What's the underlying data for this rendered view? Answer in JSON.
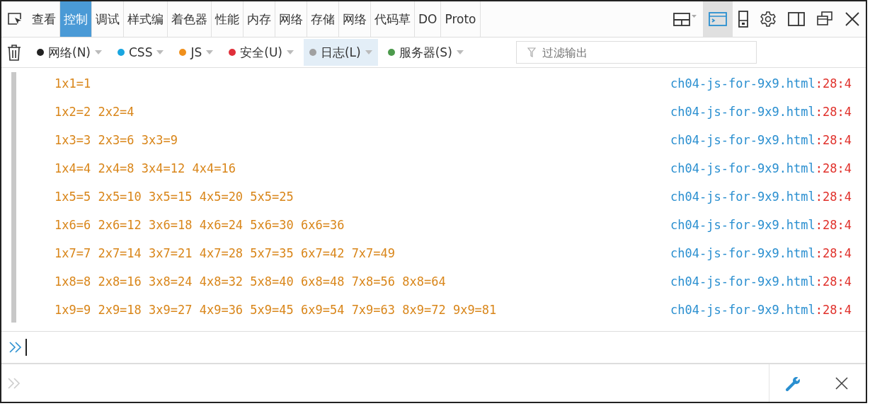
{
  "tabs": [
    {
      "label": "查看",
      "selected": false
    },
    {
      "label": "控制",
      "selected": true
    },
    {
      "label": "调试",
      "selected": false
    },
    {
      "label": "样式编",
      "selected": false
    },
    {
      "label": "着色器",
      "selected": false
    },
    {
      "label": "性能",
      "selected": false
    },
    {
      "label": "内存",
      "selected": false
    },
    {
      "label": "网络",
      "selected": false
    },
    {
      "label": "存储",
      "selected": false
    },
    {
      "label": "网络",
      "selected": false
    },
    {
      "label": "代码草",
      "selected": false
    },
    {
      "label": "DO",
      "selected": false
    },
    {
      "label": "Proto",
      "selected": false
    }
  ],
  "filters": [
    {
      "label": "网络(N)",
      "color": "#222222",
      "selected": false
    },
    {
      "label": "CSS",
      "color": "#1aa6e0",
      "selected": false
    },
    {
      "label": "JS",
      "color": "#f0901c",
      "selected": false
    },
    {
      "label": "安全(U)",
      "color": "#e0303a",
      "selected": false
    },
    {
      "label": "日志(L)",
      "color": "#a0a0a0",
      "selected": true
    },
    {
      "label": "服务器(S)",
      "color": "#4c9a4c",
      "selected": false
    }
  ],
  "filter_field": {
    "placeholder": "过滤输出"
  },
  "log": [
    {
      "message": "1x1=1",
      "source": "ch04-js-for-9x9.html",
      "location": ":28:4"
    },
    {
      "message": "1x2=2 2x2=4",
      "source": "ch04-js-for-9x9.html",
      "location": ":28:4"
    },
    {
      "message": "1x3=3 2x3=6 3x3=9",
      "source": "ch04-js-for-9x9.html",
      "location": ":28:4"
    },
    {
      "message": "1x4=4 2x4=8 3x4=12 4x4=16",
      "source": "ch04-js-for-9x9.html",
      "location": ":28:4"
    },
    {
      "message": "1x5=5 2x5=10 3x5=15 4x5=20 5x5=25",
      "source": "ch04-js-for-9x9.html",
      "location": ":28:4"
    },
    {
      "message": "1x6=6 2x6=12 3x6=18 4x6=24 5x6=30 6x6=36",
      "source": "ch04-js-for-9x9.html",
      "location": ":28:4"
    },
    {
      "message": "1x7=7 2x7=14 3x7=21 4x7=28 5x7=35 6x7=42 7x7=49",
      "source": "ch04-js-for-9x9.html",
      "location": ":28:4"
    },
    {
      "message": "1x8=8 2x8=16 3x8=24 4x8=32 5x8=40 6x8=48 7x8=56 8x8=64",
      "source": "ch04-js-for-9x9.html",
      "location": ":28:4"
    },
    {
      "message": "1x9=9 2x9=18 3x9=27 4x9=36 5x9=45 6x9=54 7x9=63 8x9=72 9x9=81",
      "source": "ch04-js-for-9x9.html",
      "location": ":28:4"
    }
  ]
}
